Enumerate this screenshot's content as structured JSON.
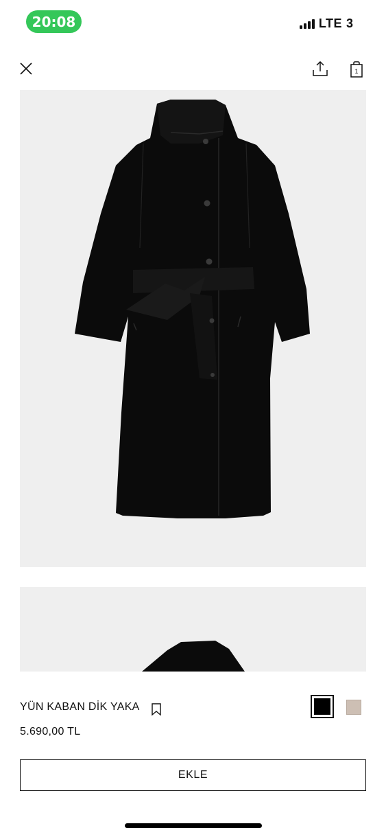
{
  "status_bar": {
    "time": "20:08",
    "network": "LTE",
    "battery": "3",
    "time_color": "#34c759"
  },
  "nav": {
    "close_icon": "close-icon",
    "share_icon": "share-icon",
    "cart_icon": "shopping-bag-icon",
    "cart_count": "1"
  },
  "product": {
    "name": "YÜN KABAN DİK YAKA",
    "price": "5.690,00 TL",
    "bookmark_icon": "bookmark-icon",
    "colors": [
      {
        "name": "black",
        "hex": "#000000",
        "selected": true
      },
      {
        "name": "beige",
        "hex": "#cdbfb4",
        "selected": false
      }
    ]
  },
  "actions": {
    "add_label": "EKLE"
  }
}
